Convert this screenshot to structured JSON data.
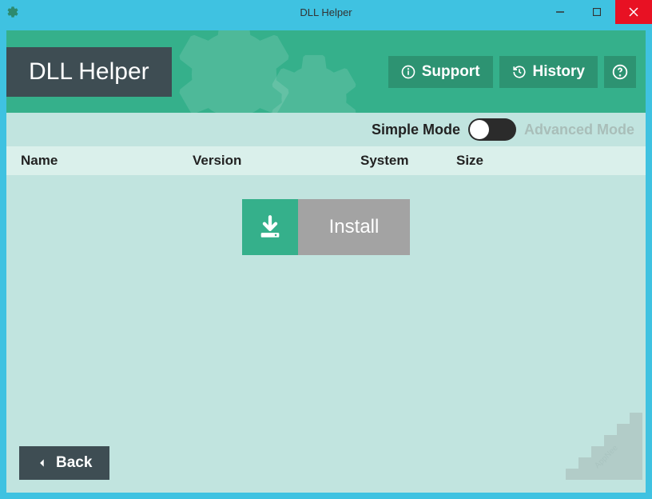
{
  "window": {
    "title": "DLL Helper"
  },
  "app": {
    "title": "DLL Helper"
  },
  "header_buttons": {
    "support": "Support",
    "history": "History"
  },
  "mode": {
    "simple": "Simple Mode",
    "advanced": "Advanced Mode"
  },
  "table": {
    "columns": {
      "name": "Name",
      "version": "Version",
      "system": "System",
      "size": "Size"
    }
  },
  "actions": {
    "install": "Install",
    "back": "Back"
  },
  "colors": {
    "titlebar": "#3fc2e1",
    "header": "#35b08b",
    "dark": "#3e4d53",
    "button": "#2d9372",
    "body": "#c1e4df"
  }
}
